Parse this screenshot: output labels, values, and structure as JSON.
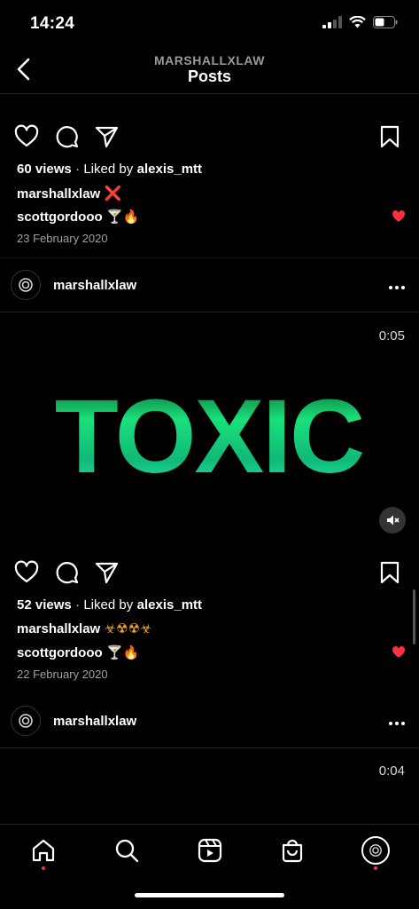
{
  "status_bar": {
    "time": "14:24"
  },
  "header": {
    "username": "MARSHALLXLAW",
    "title": "Posts"
  },
  "posts": [
    {
      "views": "60 views",
      "liked_prefix": "Liked by",
      "liked_by": "alexis_mtt",
      "caption_user": "marshallxlaw",
      "caption_emoji": "❌",
      "comment_user": "scottgordooo",
      "comment_emoji": "🍸🔥",
      "date": "23 February 2020"
    },
    {
      "author": "marshallxlaw",
      "video_time": "0:05",
      "video_text": "TOXIC",
      "views": "52 views",
      "liked_prefix": "Liked by",
      "liked_by": "alexis_mtt",
      "caption_user": "marshallxlaw",
      "caption_emoji": "☣☢☢☣",
      "comment_user": "scottgordooo",
      "comment_emoji": "🍸🔥",
      "date": "22 February 2020"
    },
    {
      "author": "marshallxlaw",
      "video_time": "0:04"
    }
  ],
  "colors": {
    "accent_red": "#ff3040",
    "video_green": "#18e07a",
    "bg": "#000000"
  },
  "tabs": [
    "home-icon",
    "search-icon",
    "reels-icon",
    "shop-icon",
    "profile-icon"
  ]
}
